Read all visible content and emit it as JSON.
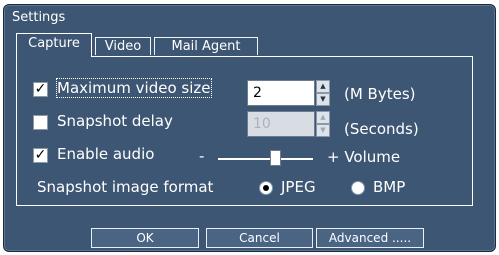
{
  "window": {
    "title": "Settings"
  },
  "tabs": [
    {
      "label": "Capture",
      "active": true
    },
    {
      "label": "Video",
      "active": false
    },
    {
      "label": "Mail Agent",
      "active": false
    }
  ],
  "capture": {
    "max_video_size": {
      "label": "Maximum video size",
      "checked": true,
      "value": "2",
      "unit": "(M Bytes)"
    },
    "snapshot_delay": {
      "label": "Snapshot delay",
      "checked": false,
      "value": "10",
      "unit": "(Seconds)",
      "disabled": true
    },
    "enable_audio": {
      "label": "Enable audio",
      "checked": true
    },
    "volume": {
      "minus_label": "-",
      "plus_label": "+ Volume",
      "level": 0.6
    },
    "snapshot_format": {
      "label": "Snapshot image format",
      "options": [
        {
          "label": "JPEG",
          "selected": true
        },
        {
          "label": "BMP",
          "selected": false
        }
      ]
    }
  },
  "buttons": {
    "ok": "OK",
    "cancel": "Cancel",
    "advanced": "Advanced ....."
  },
  "colors": {
    "background": "#3d5673",
    "text": "#ffffff"
  }
}
